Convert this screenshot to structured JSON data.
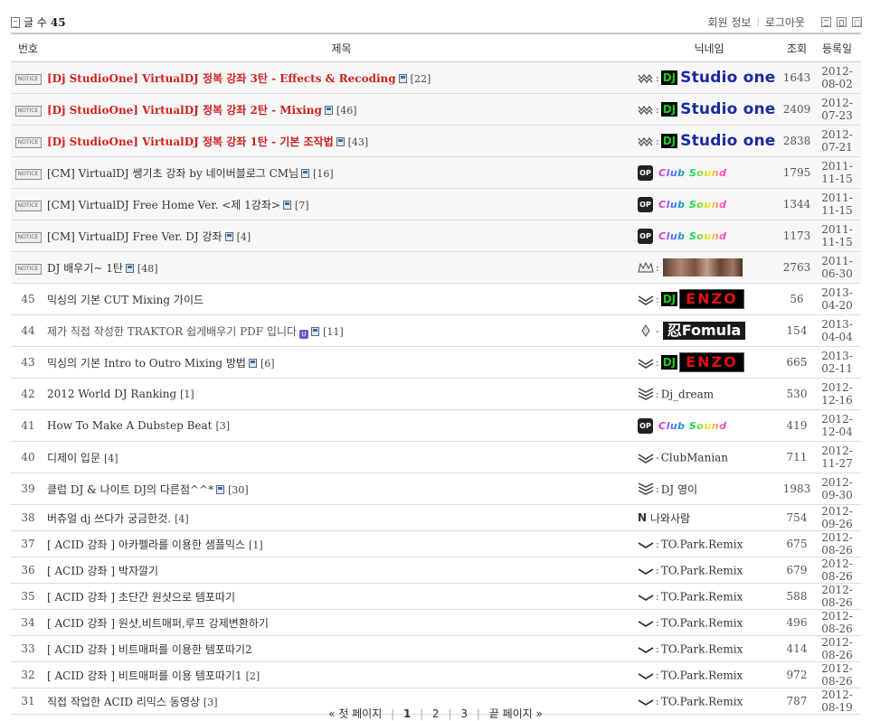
{
  "header": {
    "count_label": "글 수",
    "count_value": "45",
    "member_info": "회원 정보",
    "logout": "로그아웃"
  },
  "columns": {
    "no": "번호",
    "subject": "제목",
    "nickname": "닉네임",
    "views": "조회",
    "date": "등록일"
  },
  "notice_label": "NOTICE",
  "notices": [
    {
      "subject": "[Dj StudioOne] VirtualDJ 정복 강좌 3탄 - Effects & Recoding",
      "comments": "[22]",
      "nick_logo": "Studio one",
      "dj_label": "DJ",
      "views": "1643",
      "date": "2012-08-02"
    },
    {
      "subject": "[Dj StudioOne] VirtualDJ 정복 강좌 2탄 - Mixing",
      "comments": "[46]",
      "nick_logo": "Studio one",
      "dj_label": "DJ",
      "views": "2409",
      "date": "2012-07-23"
    },
    {
      "subject": "[Dj StudioOne] VirtualDJ 정복 강좌 1탄 - 기본 조작법",
      "comments": "[43]",
      "nick_logo": "Studio one",
      "dj_label": "DJ",
      "views": "2838",
      "date": "2012-07-21"
    },
    {
      "subject": "[CM] VirtualDJ 쌩기초 강좌 by 네이버블로그 CM님",
      "comments": "[16]",
      "op_label": "OP",
      "nick_logo": "Club Sound",
      "views": "1795",
      "date": "2011-11-15"
    },
    {
      "subject": "[CM] VirtualDJ Free Home Ver. <제 1강좌>",
      "comments": "[7]",
      "op_label": "OP",
      "nick_logo": "Club Sound",
      "views": "1344",
      "date": "2011-11-15"
    },
    {
      "subject": "[CM] VirtualDJ Free Ver. DJ 강좌",
      "comments": "[4]",
      "op_label": "OP",
      "nick_logo": "Club Sound",
      "views": "1173",
      "date": "2011-11-15"
    },
    {
      "subject": "DJ 배우기~ 1탄",
      "comments": "[48]",
      "views": "2763",
      "date": "2011-06-30"
    }
  ],
  "posts": [
    {
      "no": "45",
      "subject": "믹싱의 기본 CUT Mixing 가이드",
      "comments": "",
      "nick_logo": "ENZO",
      "dj_label": "DJ",
      "views": "56",
      "date": "2013-04-20"
    },
    {
      "no": "44",
      "subject": "제가 직접 작성한 TRAKTOR 쉽게배우기 PDF 입니다",
      "comments": "[11]",
      "nick_logo": "Fomula",
      "fomula_prefix": "忍",
      "views": "154",
      "date": "2013-04-04"
    },
    {
      "no": "43",
      "subject": "믹싱의 기본 Intro to Outro Mixing 방법",
      "comments": "[6]",
      "nick_logo": "ENZO",
      "dj_label": "DJ",
      "views": "665",
      "date": "2013-02-11"
    },
    {
      "no": "42",
      "subject": "2012 World DJ Ranking",
      "comments": "[1]",
      "nick": "Dj_dream",
      "views": "530",
      "date": "2012-12-16"
    },
    {
      "no": "41",
      "subject": "How To Make A Dubstep Beat",
      "comments": "[3]",
      "op_label": "OP",
      "nick_logo": "Club Sound",
      "views": "419",
      "date": "2012-12-04"
    },
    {
      "no": "40",
      "subject": "디제이 입문",
      "comments": "[4]",
      "nick": "ClubManian",
      "views": "711",
      "date": "2012-11-27"
    },
    {
      "no": "39",
      "subject": "클럽 DJ & 나이트 DJ의 다른점^^*",
      "comments": "[30]",
      "nick": "DJ 영이",
      "views": "1983",
      "date": "2012-09-30"
    },
    {
      "no": "38",
      "subject": "버츄얼 dj 쓰다가 궁금한것.",
      "comments": "[4]",
      "nick": "나와사람",
      "nbadge": "N",
      "views": "754",
      "date": "2012-09-26"
    },
    {
      "no": "37",
      "subject": "[ ACID 강좌 ] 아카펠라를 이용한 샘플믹스",
      "comments": "[1]",
      "nick": "TO.Park.Remix",
      "views": "675",
      "date": "2012-08-26"
    },
    {
      "no": "36",
      "subject": "[ ACID 강좌 ] 박자깔기",
      "comments": "",
      "nick": "TO.Park.Remix",
      "views": "679",
      "date": "2012-08-26"
    },
    {
      "no": "35",
      "subject": "[ ACID 강좌 ] 초단간 원샷으로 템포따기",
      "comments": "",
      "nick": "TO.Park.Remix",
      "views": "588",
      "date": "2012-08-26"
    },
    {
      "no": "34",
      "subject": "[ ACID 강좌 ] 원샷,비트매퍼,루프 강제변환하기",
      "comments": "",
      "nick": "TO.Park.Remix",
      "views": "496",
      "date": "2012-08-26"
    },
    {
      "no": "33",
      "subject": "[ ACID 강좌 ] 비트매퍼를 이용한 템포따기2",
      "comments": "",
      "nick": "TO.Park.Remix",
      "views": "414",
      "date": "2012-08-26"
    },
    {
      "no": "32",
      "subject": "[ ACID 강좌 ] 비트매퍼를 이용 템포따기1",
      "comments": "[2]",
      "nick": "TO.Park.Remix",
      "views": "972",
      "date": "2012-08-26"
    },
    {
      "no": "31",
      "subject": "직접 작업한 ACID 리믹스 동영상",
      "comments": "[3]",
      "nick": "TO.Park.Remix",
      "views": "787",
      "date": "2012-08-19"
    }
  ],
  "pagination": {
    "first": "« 첫 페이지",
    "pages": [
      "1",
      "2",
      "3"
    ],
    "last": "끝 페이지 »"
  }
}
